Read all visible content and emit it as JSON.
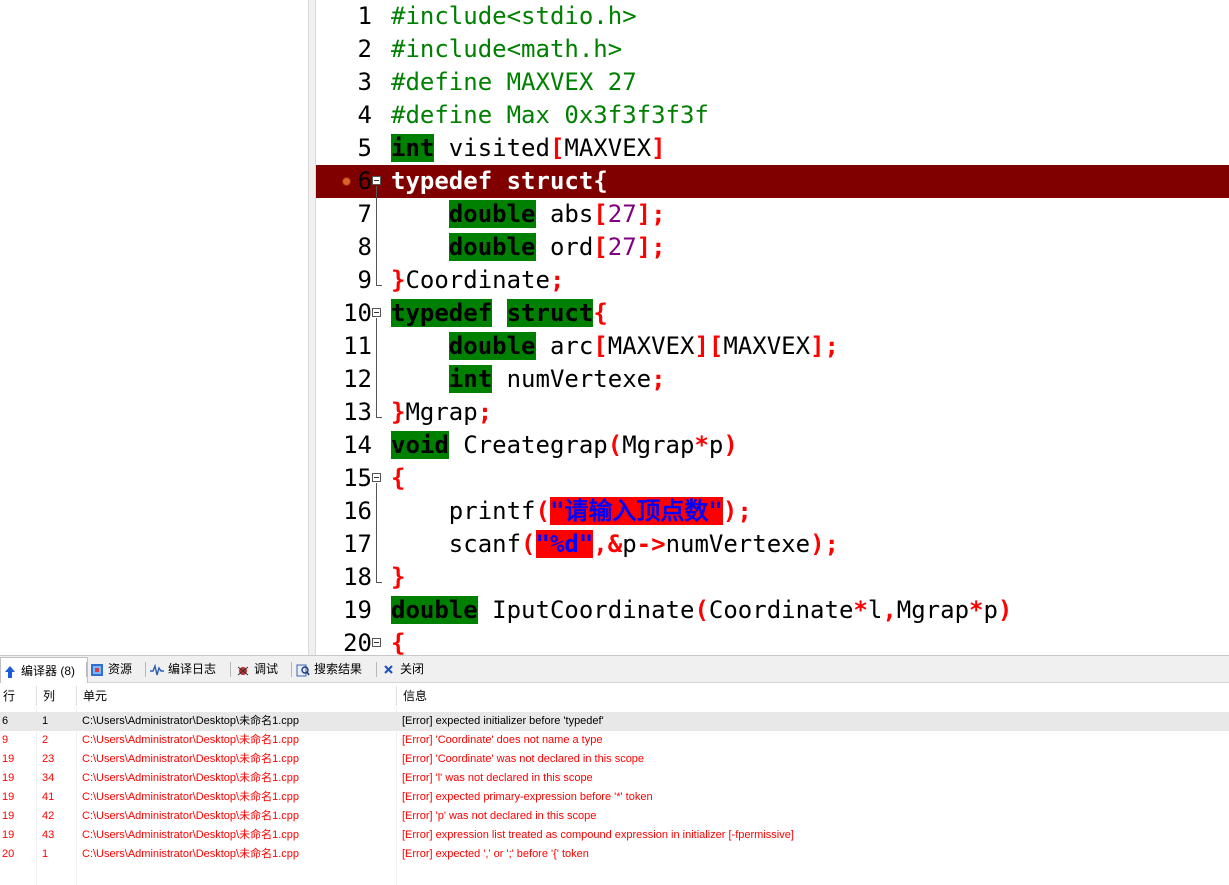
{
  "editor": {
    "active_line": 6,
    "breakpoint_line": 6,
    "lines": [
      {
        "num": "1"
      },
      {
        "num": "2"
      },
      {
        "num": "3"
      },
      {
        "num": "4"
      },
      {
        "num": "5"
      },
      {
        "num": "6"
      },
      {
        "num": "7"
      },
      {
        "num": "8"
      },
      {
        "num": "9"
      },
      {
        "num": "10"
      },
      {
        "num": "11"
      },
      {
        "num": "12"
      },
      {
        "num": "13"
      },
      {
        "num": "14"
      },
      {
        "num": "15"
      },
      {
        "num": "16"
      },
      {
        "num": "17"
      },
      {
        "num": "18"
      },
      {
        "num": "19"
      },
      {
        "num": "20"
      }
    ],
    "tokens": {
      "l1": "#include<stdio.h>",
      "l2": "#include<math.h>",
      "l3": "#define MAXVEX 27",
      "l4": "#define Max 0x3f3f3f3f",
      "int": "int",
      "visited": " visited",
      "lbr": "[",
      "rbr": "]",
      "MAXVEX": "MAXVEX",
      "typedef": "typedef",
      "struct": "struct",
      "lbrace": "{",
      "rbrace": "}",
      "double": "double",
      "abs": " abs",
      "ord": " ord",
      "n27": "27",
      "semi": ";",
      "Coordinate": "Coordinate",
      "arc": " arc",
      "numVertexe_decl": " numVertexe",
      "Mgrap": "Mgrap",
      "void": "void",
      "Creategrap": " Creategrap",
      "lparen": "(",
      "rparen": ")",
      "star": "*",
      "p": "p",
      "printf": "printf",
      "str_prompt": "\"请输入顶点数\"",
      "scanf": "scanf",
      "str_fmt": "\"%d\"",
      "comma": ",",
      "amp": "&",
      "arrow": "->",
      "numVertexe": "numVertexe",
      "IputCoordinate": " IputCoordinate",
      "l": "l",
      "indent": "    ",
      "space": " "
    }
  },
  "bottom_panel": {
    "tabs": [
      {
        "label": "编译器 (8)",
        "icon": "compiler-icon",
        "active": true
      },
      {
        "label": "资源",
        "icon": "resources-icon"
      },
      {
        "label": "编译日志",
        "icon": "compile-log-icon"
      },
      {
        "label": "调试",
        "icon": "debug-icon"
      },
      {
        "label": "搜索结果",
        "icon": "search-results-icon"
      },
      {
        "label": "关闭",
        "icon": "close-icon"
      }
    ],
    "columns": {
      "line": "行",
      "col": "列",
      "unit": "单元",
      "info": "信息"
    },
    "messages": [
      {
        "line": "6",
        "col": "1",
        "unit": "C:\\Users\\Administrator\\Desktop\\未命名1.cpp",
        "info": "[Error] expected initializer before 'typedef'"
      },
      {
        "line": "9",
        "col": "2",
        "unit": "C:\\Users\\Administrator\\Desktop\\未命名1.cpp",
        "info": "[Error] 'Coordinate' does not name a type"
      },
      {
        "line": "19",
        "col": "23",
        "unit": "C:\\Users\\Administrator\\Desktop\\未命名1.cpp",
        "info": "[Error] 'Coordinate' was not declared in this scope"
      },
      {
        "line": "19",
        "col": "34",
        "unit": "C:\\Users\\Administrator\\Desktop\\未命名1.cpp",
        "info": "[Error] 'l' was not declared in this scope"
      },
      {
        "line": "19",
        "col": "41",
        "unit": "C:\\Users\\Administrator\\Desktop\\未命名1.cpp",
        "info": "[Error] expected primary-expression before '*' token"
      },
      {
        "line": "19",
        "col": "42",
        "unit": "C:\\Users\\Administrator\\Desktop\\未命名1.cpp",
        "info": "[Error] 'p' was not declared in this scope"
      },
      {
        "line": "19",
        "col": "43",
        "unit": "C:\\Users\\Administrator\\Desktop\\未命名1.cpp",
        "info": "[Error] expression list treated as compound expression in initializer [-fpermissive]"
      },
      {
        "line": "20",
        "col": "1",
        "unit": "C:\\Users\\Administrator\\Desktop\\未命名1.cpp",
        "info": "[Error] expected ',' or ';' before '{' token"
      }
    ]
  },
  "colors": {
    "active_line_bg": "#800000",
    "keyword_bg": "#008000",
    "preprocessor": "#008000",
    "symbol": "#ff0000",
    "number": "#800080",
    "string_bg": "#ff0000",
    "string_fg": "#0000ff",
    "error_text": "#ff0000"
  }
}
